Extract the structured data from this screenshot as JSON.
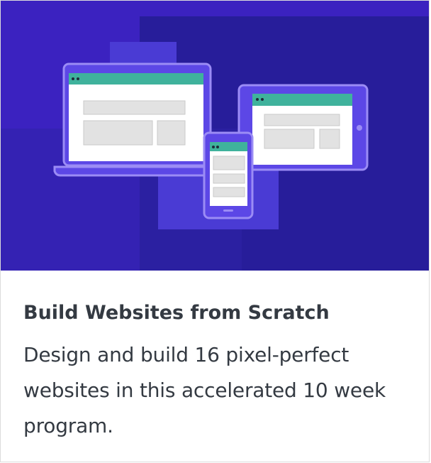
{
  "card": {
    "title": "Build Websites from Scratch",
    "description": "Design and build 16 pixel-perfect websites in this accelerated 10 week program."
  },
  "colors": {
    "hero_background": "#3b22c0",
    "hero_dark_panel": "#271d9a",
    "hero_light_panel": "#4a3bd4",
    "device_frame": "#5c47e6",
    "device_outline": "#9b8cf5",
    "browser_bar": "#3fb29c",
    "placeholder_block": "#e2e2e2",
    "text": "#343a42"
  },
  "illustration": {
    "devices": [
      "laptop-icon",
      "tablet-icon",
      "phone-icon"
    ]
  }
}
